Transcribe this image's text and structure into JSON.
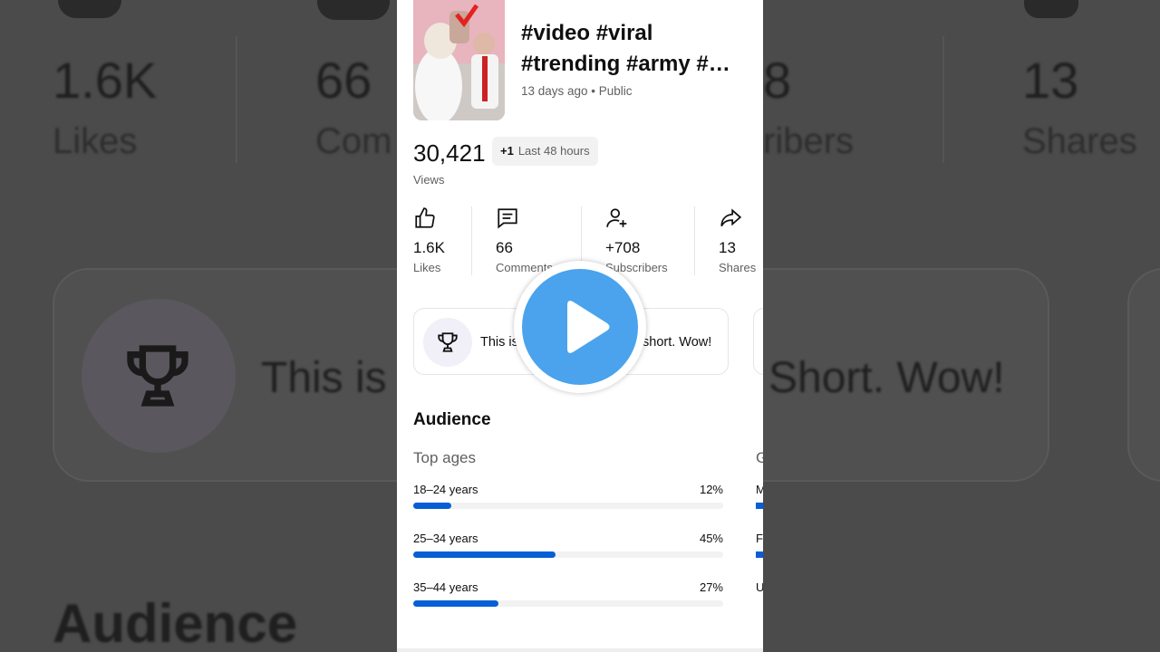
{
  "video": {
    "title_line1": "#video #viral",
    "title_line2": "#trending #army #…",
    "meta": "13 days ago • Public"
  },
  "views": {
    "count": "30,421",
    "delta": "+1",
    "delta_period": "Last 48 hours",
    "label": "Views"
  },
  "stats": [
    {
      "icon": "thumbs-up-icon",
      "value": "1.6K",
      "label": "Likes"
    },
    {
      "icon": "comment-icon",
      "value": "66",
      "label": "Comments"
    },
    {
      "icon": "add-person-icon",
      "value": "+708",
      "label": "Subscribers"
    },
    {
      "icon": "share-icon",
      "value": "13",
      "label": "Shares"
    }
  ],
  "milestone": {
    "icon": "trophy-icon",
    "text_start": "This is",
    "text_end": "short. Wow!"
  },
  "audience": {
    "title": "Audience",
    "top_ages_title": "Top ages",
    "gender_peek": "G",
    "ages": [
      {
        "label": "18–24 years",
        "percent": "12%",
        "fraction": 0.12
      },
      {
        "label": "25–34 years",
        "percent": "45%",
        "fraction": 0.45
      },
      {
        "label": "35–44 years",
        "percent": "27%",
        "fraction": 0.27
      }
    ],
    "gender_peeks": [
      "M",
      "F",
      "U"
    ]
  },
  "background": {
    "likes_value": "1.6K",
    "likes_label": "Likes",
    "comments_value": "66",
    "comments_label": "Com",
    "subs_value": "8",
    "subs_label": "ribers",
    "shares_value": "13",
    "shares_label": "Shares",
    "milestone_start": "This is",
    "milestone_end": "Short. Wow!",
    "audience": "Audience"
  },
  "overlay": {
    "icon": "play-icon",
    "color": "#4aa3ec"
  },
  "colors": {
    "accent_bar": "#065fd4",
    "secondary_text": "#606060"
  }
}
